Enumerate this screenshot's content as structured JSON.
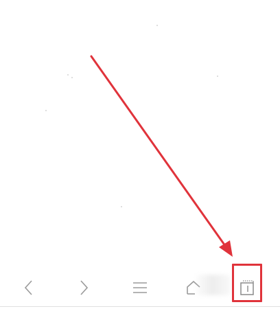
{
  "accent_color": "#e0333b",
  "bottom_nav": {
    "buttons": [
      {
        "id": "back",
        "icon": "chevron-left-icon"
      },
      {
        "id": "forward",
        "icon": "chevron-right-icon"
      },
      {
        "id": "menu",
        "icon": "hamburger-menu-icon"
      },
      {
        "id": "home",
        "icon": "home-icon"
      },
      {
        "id": "windows",
        "icon": "window-switcher-icon"
      }
    ]
  },
  "annotation": {
    "type": "arrow",
    "color": "#e0333b",
    "target": "windows"
  }
}
